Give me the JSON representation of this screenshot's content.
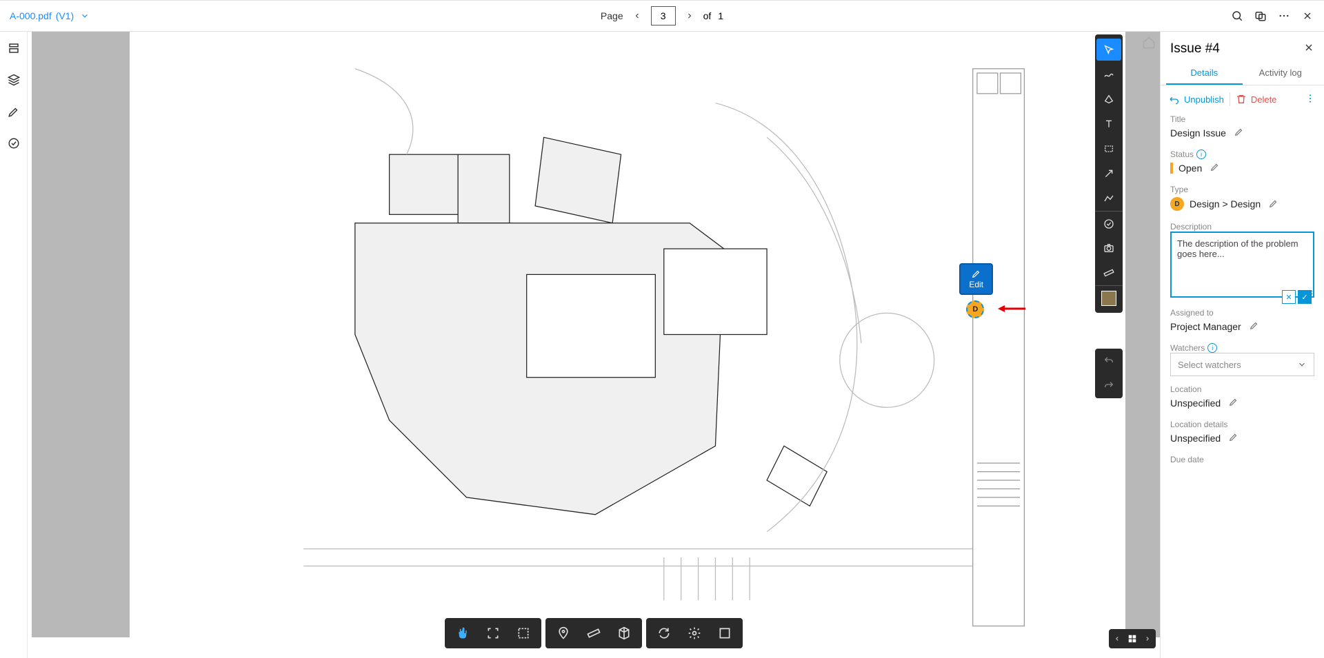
{
  "file": {
    "name": "A-000.pdf",
    "version": "(V1)"
  },
  "pager": {
    "label": "Page",
    "current": "3",
    "of_label": "of",
    "total": "1"
  },
  "edit_tooltip": "Edit",
  "marker_letter": "D",
  "issue": {
    "title": "Issue #4",
    "tabs": {
      "details": "Details",
      "activity": "Activity log"
    },
    "actions": {
      "unpublish": "Unpublish",
      "delete": "Delete"
    },
    "fields": {
      "title_label": "Title",
      "title_value": "Design Issue",
      "status_label": "Status",
      "status_value": "Open",
      "type_label": "Type",
      "type_value": "Design > Design",
      "description_label": "Description",
      "description_value": "The description of the problem goes here...",
      "assigned_label": "Assigned to",
      "assigned_value": "Project Manager",
      "watchers_label": "Watchers",
      "watchers_placeholder": "Select watchers",
      "location_label": "Location",
      "location_value": "Unspecified",
      "location_details_label": "Location details",
      "location_details_value": "Unspecified",
      "due_date_label": "Due date"
    }
  }
}
